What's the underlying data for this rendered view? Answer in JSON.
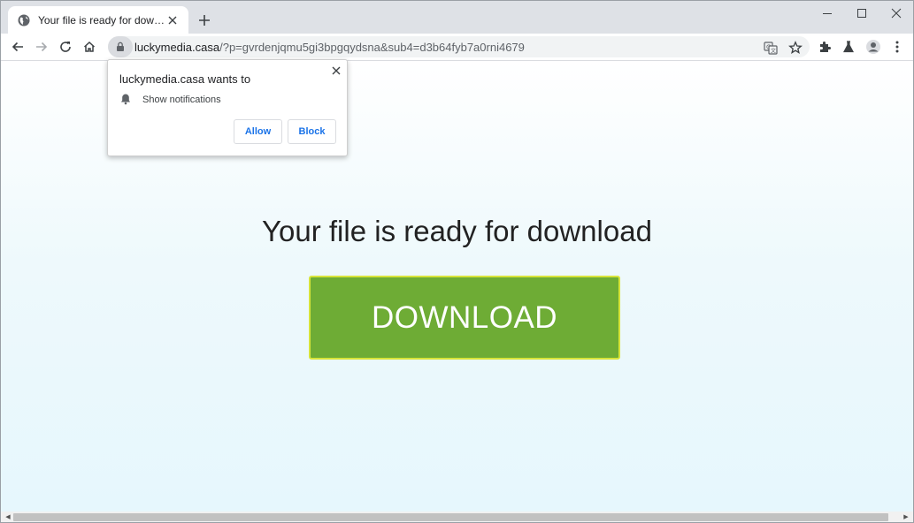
{
  "tab": {
    "title": "Your file is ready for download"
  },
  "address_bar": {
    "host": "luckymedia.casa",
    "path": "/?p=gvrdenjqmu5gi3bpgqydsna&sub4=d3b64fyb7a0rni4679"
  },
  "popup": {
    "title": "luckymedia.casa wants to",
    "permission": "Show notifications",
    "allow_label": "Allow",
    "block_label": "Block"
  },
  "page": {
    "headline": "Your file is ready for download",
    "download_label": "DOWNLOAD"
  },
  "colors": {
    "download_button": "#6eac35",
    "download_border": "#d7e43a",
    "popup_button_text": "#1a73e8",
    "tabstrip": "#dee1e6"
  }
}
